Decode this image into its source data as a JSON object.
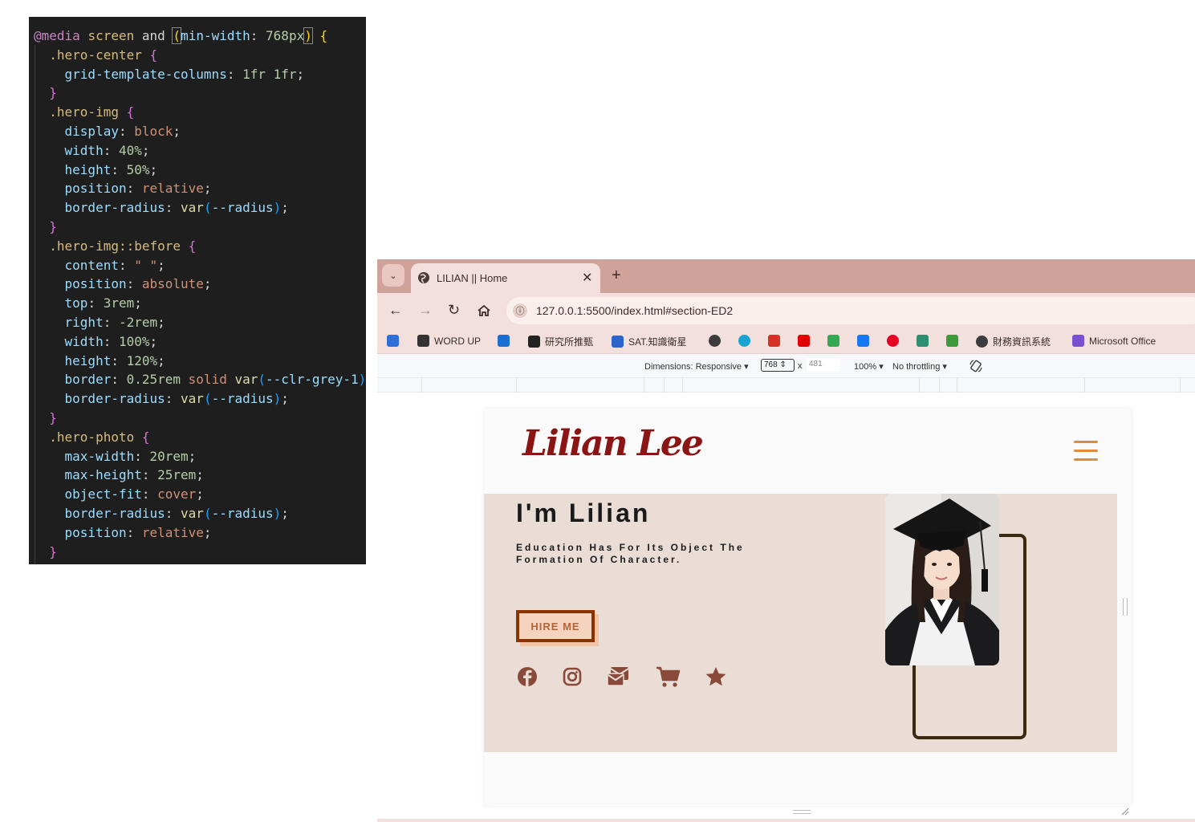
{
  "editor": {
    "lines": [
      {
        "type": "media",
        "at": "@media",
        "screen": "screen",
        "and": "and",
        "open": "(",
        "prop": "min-width",
        "colon": ": ",
        "num": "768",
        "unit": "px",
        "close": ")",
        "brace": "{"
      },
      {
        "type": "selector",
        "text": ".hero-center",
        "brace": "{"
      },
      {
        "type": "decl",
        "prop": "grid-template-columns",
        "value": "1fr 1fr",
        "kind": "num"
      },
      {
        "type": "close",
        "text": "}"
      },
      {
        "type": "selector",
        "text": ".hero-img",
        "brace": "{"
      },
      {
        "type": "decl",
        "prop": "display",
        "value": "block",
        "kind": "kw"
      },
      {
        "type": "decl",
        "prop": "width",
        "value": "40%",
        "kind": "num"
      },
      {
        "type": "decl",
        "prop": "height",
        "value": "50%",
        "kind": "num"
      },
      {
        "type": "decl",
        "prop": "position",
        "value": "relative",
        "kind": "kw"
      },
      {
        "type": "var",
        "prop": "border-radius",
        "pre": "",
        "fn": "var",
        "arg": "--radius"
      },
      {
        "type": "close",
        "text": "}"
      },
      {
        "type": "selector",
        "text": ".hero-img::before",
        "brace": "{"
      },
      {
        "type": "decl",
        "prop": "content",
        "value": "\" \"",
        "kind": "str"
      },
      {
        "type": "decl",
        "prop": "position",
        "value": "absolute",
        "kind": "kw"
      },
      {
        "type": "decl",
        "prop": "top",
        "value": "3rem",
        "kind": "num"
      },
      {
        "type": "decl",
        "prop": "right",
        "value": "-2rem",
        "kind": "num"
      },
      {
        "type": "decl",
        "prop": "width",
        "value": "100%",
        "kind": "num"
      },
      {
        "type": "decl",
        "prop": "height",
        "value": "120%",
        "kind": "num"
      },
      {
        "type": "var",
        "prop": "border",
        "pre": "0.25rem solid ",
        "fn": "var",
        "arg": "--clr-grey-1",
        "noclose": true
      },
      {
        "type": "var",
        "prop": "border-radius",
        "pre": "",
        "fn": "var",
        "arg": "--radius"
      },
      {
        "type": "close",
        "text": "}"
      },
      {
        "type": "selector",
        "text": ".hero-photo",
        "brace": "{"
      },
      {
        "type": "decl",
        "prop": "max-width",
        "value": "20rem",
        "kind": "num"
      },
      {
        "type": "decl",
        "prop": "max-height",
        "value": "25rem",
        "kind": "num"
      },
      {
        "type": "decl",
        "prop": "object-fit",
        "value": "cover",
        "kind": "kw"
      },
      {
        "type": "var",
        "prop": "border-radius",
        "pre": "",
        "fn": "var",
        "arg": "--radius"
      },
      {
        "type": "decl",
        "prop": "position",
        "value": "relative",
        "kind": "kw"
      },
      {
        "type": "close",
        "text": "}"
      }
    ]
  },
  "browser": {
    "tab_title": "LILIAN || Home",
    "tab_close": "✕",
    "new_tab": "+",
    "url": "127.0.0.1:5500/index.html#section-ED2",
    "bookmarks": [
      {
        "label": "",
        "icon": "google-drive-icon",
        "color": "#2f6fd9"
      },
      {
        "label": "WORD UP",
        "icon": "word-up-icon",
        "color": "#333333"
      },
      {
        "label": "",
        "icon": "onedrive-icon",
        "color": "#1b6fd1"
      },
      {
        "label": "研究所推甄",
        "icon": "notion-icon",
        "color": "#222222"
      },
      {
        "label": "SAT.知識衛星",
        "icon": "sat-icon",
        "color": "#2a63c9"
      },
      {
        "label": "",
        "icon": "globe-icon",
        "color": "#3c3c3c"
      },
      {
        "label": "",
        "icon": "canva-icon",
        "color": "#18a3d4"
      },
      {
        "label": "",
        "icon": "gmail-icon",
        "color": "#d93025"
      },
      {
        "label": "",
        "icon": "youtube-icon",
        "color": "#e00000"
      },
      {
        "label": "",
        "icon": "maps-icon",
        "color": "#34a853"
      },
      {
        "label": "",
        "icon": "facebook-icon",
        "color": "#1877f2"
      },
      {
        "label": "",
        "icon": "pinterest-icon",
        "color": "#e60023"
      },
      {
        "label": "",
        "icon": "tool-icon",
        "color": "#2d8f6f"
      },
      {
        "label": "",
        "icon": "spreadsheet-icon",
        "color": "#3c9a3a"
      },
      {
        "label": "財務資訊系統",
        "icon": "globe-icon",
        "color": "#3c3c3c"
      },
      {
        "label": "Microsoft Office",
        "icon": "office-icon",
        "color": "#7b4fd1"
      }
    ],
    "devtools": {
      "dimensions_label": "Dimensions: Responsive",
      "width": "768",
      "times": "x",
      "height": "481",
      "zoom": "100%",
      "throttling": "No throttling"
    }
  },
  "site": {
    "logo": "Lilian Lee",
    "hero_title": "I'm Lilian",
    "hero_subtitle": "Education Has For Its Object The Formation Of Character.",
    "cta": "HIRE ME",
    "socials": [
      "facebook-icon",
      "instagram-icon",
      "mail-icon",
      "cart-icon",
      "star-icon"
    ],
    "accent_color": "#e08a3c",
    "brand_color": "#8b1414"
  }
}
